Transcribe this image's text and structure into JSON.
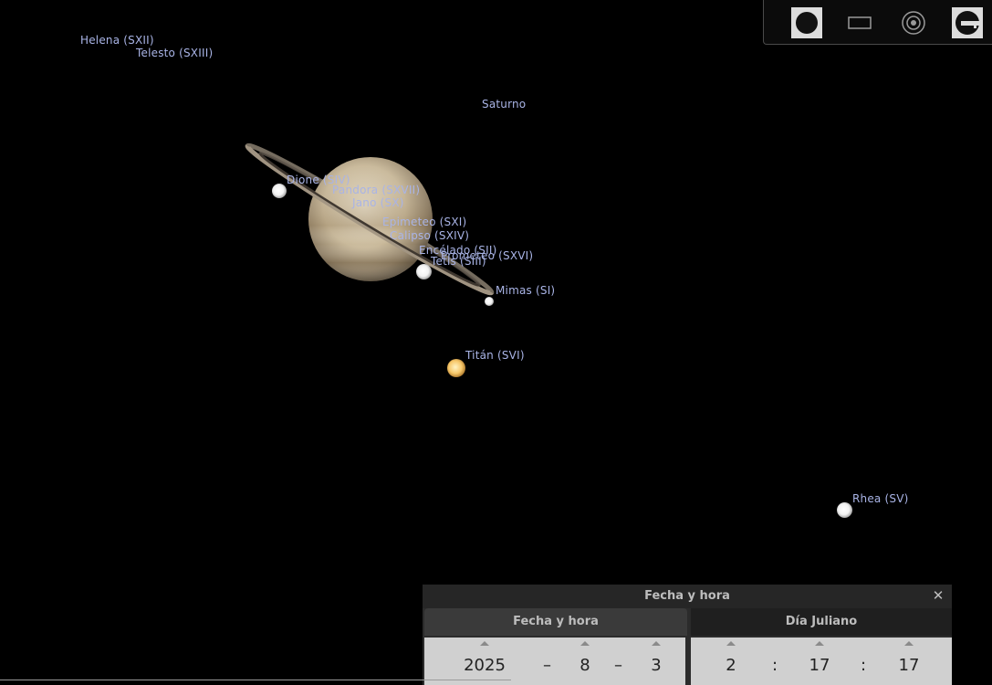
{
  "sky": {
    "planet_label": "Saturno",
    "labels": {
      "helena": "Helena (SXII)",
      "telesto": "Telesto (SXIII)",
      "dione": "Dione (SIV)",
      "pandora": "Pandora (SXVII)",
      "jano": "Jano (SX)",
      "epimeteo": "Epimeteo (SXI)",
      "calipso": "Calipso (SXIV)",
      "encelado": "Encélado (SII)",
      "prometeo": "Prometeo (SXVI)",
      "tetis": "Tetis (SIII)",
      "mimas": "Mimas (SI)",
      "titan": "Titán (SVI)",
      "rhea": "Rhea (SV)"
    },
    "label_color": "#a9b4e6"
  },
  "toolbar": {
    "buttons": [
      {
        "icon": "filled-circle-icon",
        "active": true
      },
      {
        "icon": "rectangle-icon",
        "active": false
      },
      {
        "icon": "target-icon",
        "active": false
      },
      {
        "icon": "key-icon",
        "active": true
      }
    ]
  },
  "datetime_panel": {
    "title": "Fecha y hora",
    "close_icon": "close-icon",
    "tabs": [
      "Fecha y hora",
      "Día Juliano"
    ],
    "date": {
      "year": "2025",
      "month": "8",
      "day": "3",
      "separator": "–"
    },
    "time": {
      "hour": "2",
      "minute": "17",
      "second": "17",
      "separator": ":"
    }
  }
}
